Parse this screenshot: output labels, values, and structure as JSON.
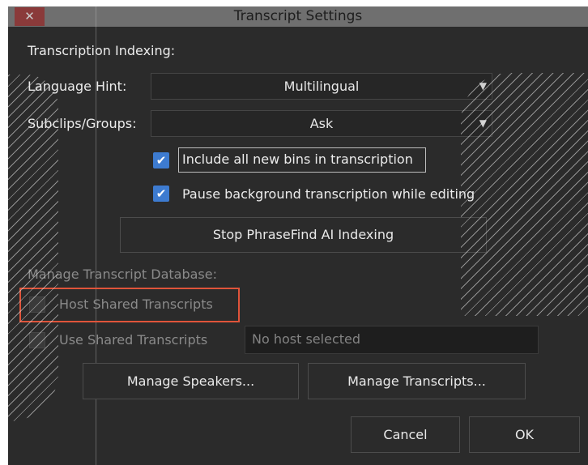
{
  "window": {
    "title": "Transcript Settings",
    "close_glyph": "✕"
  },
  "indexing": {
    "heading": "Transcription Indexing:",
    "language_label": "Language Hint:",
    "language_value": "Multilingual",
    "subclips_label": "Subclips/Groups:",
    "subclips_value": "Ask",
    "include_bins_label": "Include all new bins in transcription",
    "include_bins_checked": true,
    "pause_label": "Pause background transcription while editing",
    "pause_checked": true,
    "stop_button": "Stop PhraseFind AI Indexing"
  },
  "database": {
    "heading": "Manage Transcript Database:",
    "host_label": "Host Shared Transcripts",
    "host_checked": false,
    "use_label": "Use Shared Transcripts",
    "use_checked": false,
    "host_field_value": "No host selected",
    "manage_speakers": "Manage Speakers...",
    "manage_transcripts": "Manage Transcripts..."
  },
  "footer": {
    "cancel": "Cancel",
    "ok": "OK"
  },
  "icons": {
    "checkmark": "check-icon",
    "dropdown": "chevron-down-icon",
    "close": "close-icon"
  },
  "colors": {
    "checkbox_accent": "#3d7bd0",
    "highlight": "#e0543a",
    "close_button": "#8a3a3a"
  }
}
